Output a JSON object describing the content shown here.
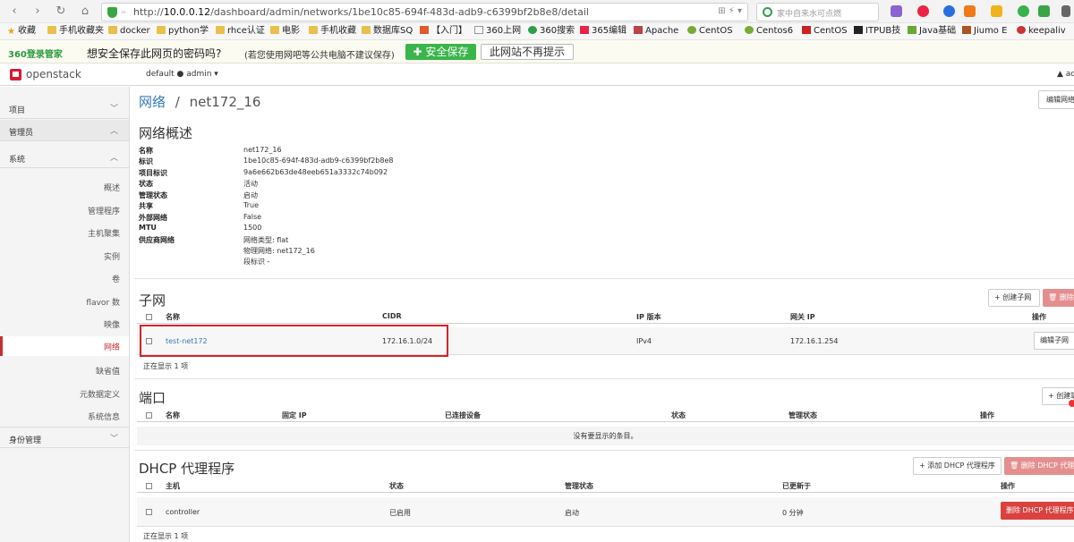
{
  "browser": {
    "url_prefix": "http://",
    "url_host": "10.0.0.12",
    "url_path": "/dashboard/admin/networks/1be10c85-694f-483d-adb9-c6399bf2b8e8/detail",
    "search_placeholder": "家中自来水可点燃",
    "address_tools": "⊞ ⚡ ▾"
  },
  "bookmarks": [
    {
      "label": "收藏",
      "icon": "star-icon"
    },
    {
      "label": "手机收藏夹",
      "icon": "folder-icon"
    },
    {
      "label": "docker",
      "icon": "folder-icon"
    },
    {
      "label": "python学",
      "icon": "folder-icon"
    },
    {
      "label": "rhce认证",
      "icon": "folder-icon"
    },
    {
      "label": "电影",
      "icon": "folder-icon"
    },
    {
      "label": "手机收藏",
      "icon": "folder-icon"
    },
    {
      "label": "数据库SQ",
      "icon": "folder-icon"
    },
    {
      "label": "【入门】",
      "icon": "site-icon"
    },
    {
      "label": "360上网",
      "icon": "page-icon"
    },
    {
      "label": "360搜索",
      "icon": "search-icon"
    },
    {
      "label": "365编辑",
      "icon": "site-icon"
    },
    {
      "label": "Apache",
      "icon": "feather-icon"
    },
    {
      "label": "CentOS",
      "icon": "site-icon"
    },
    {
      "label": "Centos6",
      "icon": "site-icon"
    },
    {
      "label": "CentOS",
      "icon": "site-icon"
    },
    {
      "label": "ITPUB技",
      "icon": "site-icon"
    },
    {
      "label": "Java基础",
      "icon": "site-icon"
    },
    {
      "label": "Jiumo E",
      "icon": "site-icon"
    },
    {
      "label": "keepaliv",
      "icon": "site-icon"
    }
  ],
  "password_bar": {
    "brand": "360登录管家",
    "question": "想安全保存此网页的密码吗?",
    "note": "(若您使用网吧等公共电脑不建议保存)",
    "save_label": "安全保存",
    "never_label": "此网站不再提示"
  },
  "header": {
    "logo": "openstack",
    "project": "default ● admin ▾",
    "user": "▲ ad"
  },
  "sidebar": {
    "groups": [
      {
        "label": "项目",
        "chevron": "﹀"
      },
      {
        "label": "管理员",
        "chevron": "︿"
      },
      {
        "label": "系统",
        "chevron": "︿"
      },
      {
        "label": "身份管理",
        "chevron": "﹀"
      }
    ],
    "items": [
      {
        "label": "概述"
      },
      {
        "label": "管理程序"
      },
      {
        "label": "主机聚集"
      },
      {
        "label": "实例"
      },
      {
        "label": "卷"
      },
      {
        "label": "flavor 数"
      },
      {
        "label": "映像"
      },
      {
        "label": "网络",
        "active": true
      },
      {
        "label": "缺省值"
      },
      {
        "label": "元数据定义"
      },
      {
        "label": "系统信息"
      }
    ]
  },
  "page": {
    "breadcrumb_root": "网络",
    "breadcrumb_sep": "/",
    "breadcrumb_current": "net172_16",
    "edit_network_label": "编辑网络"
  },
  "overview": {
    "title": "网络概述",
    "fields": [
      {
        "key": "名称",
        "value": "net172_16"
      },
      {
        "key": "标识",
        "value": "1be10c85-694f-483d-adb9-c6399bf2b8e8"
      },
      {
        "key": "项目标识",
        "value": "9a6e662b63de48eeb651a3332c74b092"
      },
      {
        "key": "状态",
        "value": "活动"
      },
      {
        "key": "管理状态",
        "value": "启动"
      },
      {
        "key": "共享",
        "value": "True"
      },
      {
        "key": "外部网络",
        "value": "False"
      },
      {
        "key": "MTU",
        "value": "1500"
      },
      {
        "key": "供应商网络",
        "value": "网络类型: flat"
      }
    ],
    "provider_extra": [
      "物理网络: net172_16",
      "段标识 -"
    ]
  },
  "subnets": {
    "title": "子网",
    "create_label": "+ 创建子网",
    "delete_label": "🗑 删除子网",
    "columns": [
      "名称",
      "CIDR",
      "IP 版本",
      "网关 IP",
      "操作"
    ],
    "rows": [
      {
        "name": "test-net172",
        "cidr": "172.16.1.0/24",
        "ip_version": "IPv4",
        "gateway": "172.16.1.254",
        "action": "编辑子网"
      }
    ],
    "footer": "正在显示 1 项"
  },
  "ports": {
    "title": "端口",
    "create_label": "+ 创建端口",
    "columns": [
      "名称",
      "固定 IP",
      "已连接设备",
      "状态",
      "管理状态",
      "操作"
    ],
    "empty": "没有要显示的条目。"
  },
  "dhcp": {
    "title": "DHCP 代理程序",
    "add_label": "+ 添加 DHCP 代理程序",
    "delete_label": "🗑 删除 DHCP 代理程序",
    "columns": [
      "主机",
      "状态",
      "管理状态",
      "已更新于",
      "操作"
    ],
    "rows": [
      {
        "host": "controller",
        "status": "已启用",
        "admin_state": "启动",
        "updated": "0 分钟",
        "action": "删除 DHCP 代理程序"
      }
    ],
    "footer": "正在显示 1 项"
  },
  "colors": {
    "accent": "#337ab7",
    "danger": "#d9423f",
    "brand": "#da1a32",
    "highlight": "#d2232a"
  }
}
